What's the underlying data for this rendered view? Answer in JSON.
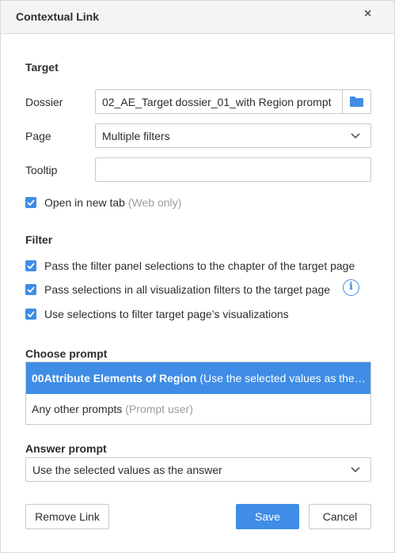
{
  "dialog": {
    "title": "Contextual Link",
    "close_glyph": "×"
  },
  "target": {
    "section_title": "Target",
    "dossier_label": "Dossier",
    "dossier_value": "02_AE_Target dossier_01_with Region prompt",
    "page_label": "Page",
    "page_value": "Multiple filters",
    "tooltip_label": "Tooltip",
    "tooltip_value": "",
    "open_new_tab_label": "Open in new tab",
    "open_new_tab_hint": "(Web only)",
    "open_new_tab_checked": true
  },
  "filter": {
    "section_title": "Filter",
    "options": [
      {
        "label": "Pass the filter panel selections to the chapter of the target page",
        "checked": true
      },
      {
        "label": "Pass selections in all visualization filters to the target page",
        "checked": true
      },
      {
        "label": "Use selections to filter target page’s visualizations",
        "checked": true
      }
    ],
    "info_glyph": "i"
  },
  "choose_prompt": {
    "section_title": "Choose prompt",
    "items": [
      {
        "name": "00Attribute Elements of Region",
        "detail": "(Use the selected values as the answer)",
        "selected": true
      },
      {
        "name": "Any other prompts",
        "detail": "(Prompt user)",
        "selected": false
      }
    ]
  },
  "answer_prompt": {
    "section_title": "Answer prompt",
    "value": "Use the selected values as the answer"
  },
  "buttons": {
    "remove_link": "Remove Link",
    "save": "Save",
    "cancel": "Cancel"
  },
  "colors": {
    "accent": "#3f8de6",
    "header_bg": "#f4f4f4",
    "muted_text": "#9a9da0"
  },
  "icons": {
    "close": "close-icon",
    "folder": "folder-icon",
    "chevron": "chevron-down-icon",
    "checkbox": "checkbox-checked-icon",
    "info": "info-icon"
  }
}
